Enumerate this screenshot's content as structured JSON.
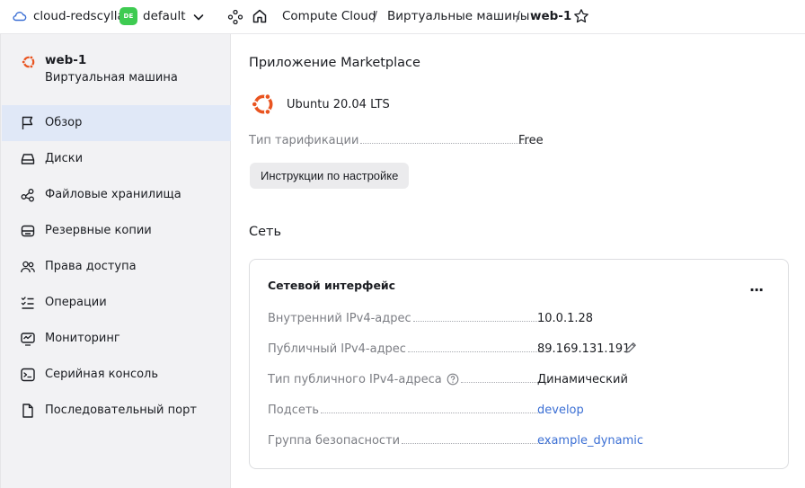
{
  "topbar": {
    "cloud_name": "cloud-redscylla",
    "folder_badge": "DE",
    "folder_name": "default",
    "breadcrumbs": [
      "Compute Cloud",
      "Виртуальные машины",
      "web-1"
    ],
    "separator": "/"
  },
  "sidebar": {
    "vm_name": "web-1",
    "vm_type": "Виртуальная машина",
    "items": [
      {
        "label": "Обзор",
        "icon": "flag-icon",
        "active": true
      },
      {
        "label": "Диски",
        "icon": "disk-icon"
      },
      {
        "label": "Файловые хранилища",
        "icon": "share-icon"
      },
      {
        "label": "Резервные копии",
        "icon": "backup-icon"
      },
      {
        "label": "Права доступа",
        "icon": "users-icon"
      },
      {
        "label": "Операции",
        "icon": "list-icon"
      },
      {
        "label": "Мониторинг",
        "icon": "monitor-icon"
      },
      {
        "label": "Серийная консоль",
        "icon": "terminal-icon"
      },
      {
        "label": "Последовательный порт",
        "icon": "file-icon"
      }
    ]
  },
  "marketplace": {
    "title": "Приложение Marketplace",
    "image_name": "Ubuntu 20.04 LTS",
    "billing_label": "Тип тарификации",
    "billing_value": "Free",
    "instructions_button": "Инструкции по настройке"
  },
  "network": {
    "title": "Сеть",
    "card_title": "Сетевой интерфейс",
    "more_label": "···",
    "rows": [
      {
        "label": "Внутренний IPv4-адрес",
        "value": "10.0.1.28"
      },
      {
        "label": "Публичный IPv4-адрес",
        "value": "89.169.131.191"
      },
      {
        "label": "Тип публичного IPv4-адреса",
        "value": "Динамический"
      },
      {
        "label": "Подсеть",
        "value": "develop"
      },
      {
        "label": "Группа безопасности",
        "value": "example_dynamic"
      }
    ]
  },
  "colors": {
    "accent": "#3b6fd4",
    "ubuntu_orange": "#e95420",
    "badge_green": "#3ecb51",
    "active_nav": "#e0e8f7"
  }
}
